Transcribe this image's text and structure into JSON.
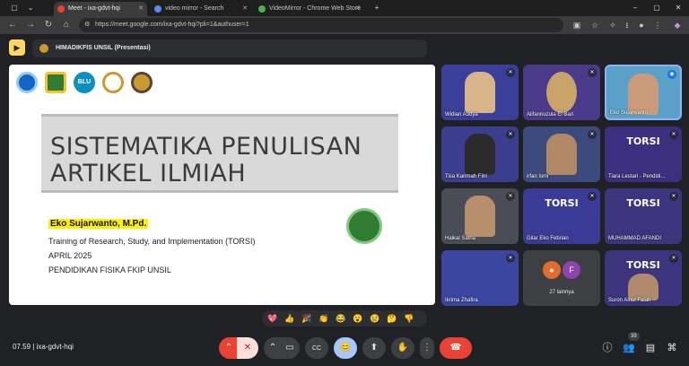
{
  "browser": {
    "tabs": [
      {
        "title": "Meet - ixa-gdvt-hqi",
        "favicon_color": "#e94235"
      },
      {
        "title": "video mirror - Search",
        "favicon_color": "#5b8def"
      },
      {
        "title": "VideoMirror - Chrome Web Store",
        "favicon_color": "#4caf50"
      }
    ],
    "new_tab": "+",
    "url": "https://meet.google.com/ixa-gdvt-hqi?pli=1&authuser=1",
    "window_controls": {
      "minimize": "–",
      "maximize": "▢",
      "close": "✕"
    }
  },
  "meet": {
    "presenter_label": "HIMADIKFIS UNSIL (Presentasi)",
    "meeting_time": "07.59",
    "meeting_code": "ixa-gdvt-hqi",
    "participant_count": "39"
  },
  "slide": {
    "title_line1": "SISTEMATIKA PENULISAN",
    "title_line2": "ARTIKEL ILMIAH",
    "author": "Eko Sujarwanto, M.Pd.",
    "line1": "Training of Research, Study, and Implementation (TORSI)",
    "line2": "APRIL 2025",
    "line3": "PENDIDIKAN FISIKA FKIP UNSIL",
    "logo_badge_text": "BLU"
  },
  "participants": [
    {
      "name": "Widian Audya",
      "bg": "#3a3f9a",
      "face": "#d8b48a",
      "muted": true
    },
    {
      "name": "Alifannuzula El Bari",
      "bg": "#4a3b8a",
      "face": "#c9a36a",
      "muted": true
    },
    {
      "name": "Eko Sujarwanto",
      "bg": "#5aa0c8",
      "face": "#c99b7a",
      "muted": false
    },
    {
      "name": "Tisa Karimah Fitri",
      "bg": "#3b3e8f",
      "face": "#2b2b2b",
      "muted": true
    },
    {
      "name": "irfan Ismi",
      "bg": "#3c4a7d",
      "face": "#b08866",
      "muted": true
    },
    {
      "name": "Tiara Lestari - Pendidi...",
      "bg": "#3d2f7f",
      "face": "#c8a088",
      "muted": true,
      "banner": "TORSI"
    },
    {
      "name": "Haikal Satria",
      "bg": "#4a4d55",
      "face": "#b78f6d",
      "muted": true
    },
    {
      "name": "Gilar Eko Febrian",
      "bg": "#3a3b96",
      "face": "",
      "muted": true,
      "banner": "TORSI"
    },
    {
      "name": "MUHAMMAD AFANDI",
      "bg": "#3c357e",
      "face": "",
      "muted": true,
      "banner": "TORSI"
    },
    {
      "name": "Ikrima Zhafira",
      "bg": "#3b46a0",
      "face": "",
      "muted": true
    },
    {
      "name": "Suron Ainul Falah",
      "bg": "#3c357e",
      "face": "#b08a6a",
      "muted": true,
      "banner": "TORSI"
    }
  ],
  "more_participants": {
    "label": "27 lainnya",
    "avatar1_color": "#e46a2e",
    "avatar2_color": "#8e44ad",
    "avatar2_letter": "F"
  },
  "reactions": [
    "💖",
    "👍",
    "🎉",
    "👏",
    "😂",
    "😮",
    "😢",
    "🤔",
    "👎"
  ],
  "controls": {
    "mic_chevron": "⌃",
    "mic_off": "🎙",
    "cam_chevron": "⌃",
    "cam": "📷",
    "captions": "CC",
    "emoji": "😊",
    "present": "⬆",
    "raise_hand": "✋",
    "more": "⋮",
    "end_call": "☎"
  }
}
